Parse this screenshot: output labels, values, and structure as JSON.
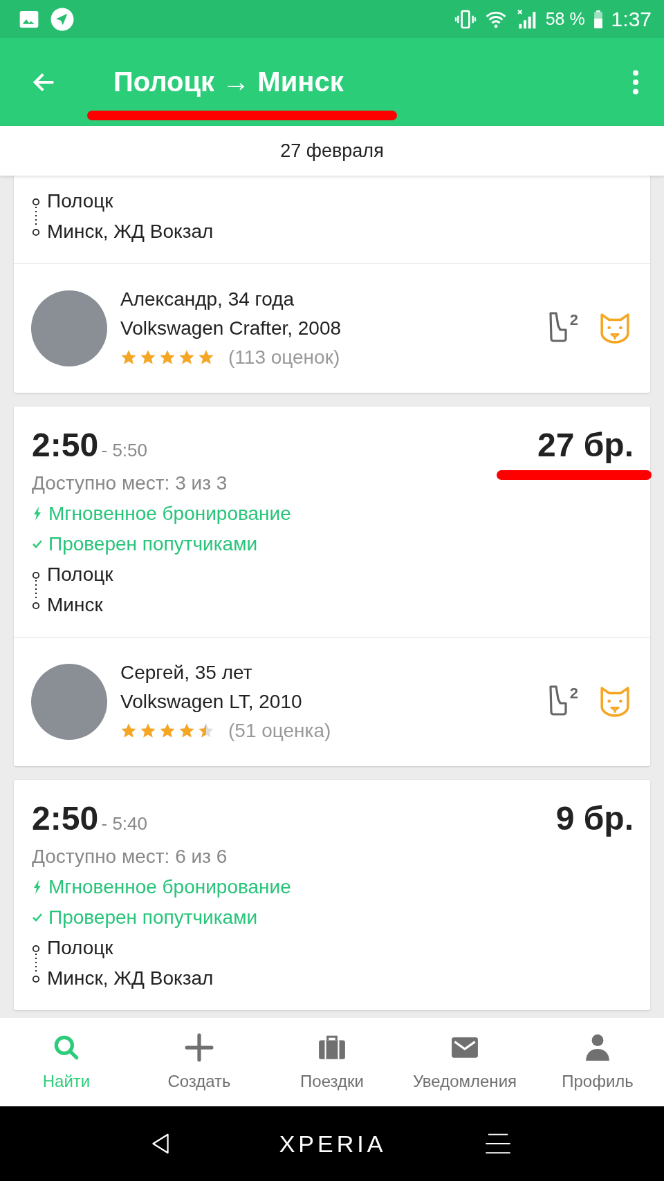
{
  "status_bar": {
    "battery": "58 %",
    "time": "1:37"
  },
  "app_bar": {
    "title": "Полоцк → Минск",
    "title_underlined": true
  },
  "date": "27 февраля",
  "trips": [
    {
      "price_underlined": false,
      "stops": [
        "Полоцк",
        "Минск, ЖД Вокзал"
      ],
      "driver": {
        "name": "Александр, 34 года",
        "car": "Volkswagen Crafter, 2008",
        "stars": 5,
        "reviews": "(113 оценок)",
        "seat_badge": "2"
      }
    },
    {
      "time": "2:50",
      "end_time": "- 5:50",
      "price": "27 бр.",
      "price_underlined": true,
      "seats": "Доступно мест: 3 из 3",
      "features": [
        {
          "kind": "instant",
          "label": "Мгновенное бронирование"
        },
        {
          "kind": "verified",
          "label": "Проверен попутчиками"
        }
      ],
      "stops": [
        "Полоцк",
        "Минск"
      ],
      "driver": {
        "name": "Сергей, 35 лет",
        "car": "Volkswagen LT, 2010",
        "stars": 4.5,
        "reviews": "(51 оценка)",
        "seat_badge": "2"
      }
    },
    {
      "time": "2:50",
      "end_time": "- 5:40",
      "price": "9 бр.",
      "price_underlined": false,
      "seats": "Доступно мест: 6 из 6",
      "features": [
        {
          "kind": "instant",
          "label": "Мгновенное бронирование"
        },
        {
          "kind": "verified",
          "label": "Проверен попутчиками"
        }
      ],
      "stops": [
        "Полоцк",
        "Минск, ЖД Вокзал"
      ]
    }
  ],
  "bottom_nav": [
    {
      "kind": "search",
      "label": "Найти",
      "selected": true
    },
    {
      "kind": "create",
      "label": "Создать",
      "selected": false
    },
    {
      "kind": "trips",
      "label": "Поездки",
      "selected": false
    },
    {
      "kind": "notifications",
      "label": "Уведомления",
      "selected": false
    },
    {
      "kind": "profile",
      "label": "Профиль",
      "selected": false
    }
  ],
  "system_bar": {
    "brand": "XPERIA"
  }
}
